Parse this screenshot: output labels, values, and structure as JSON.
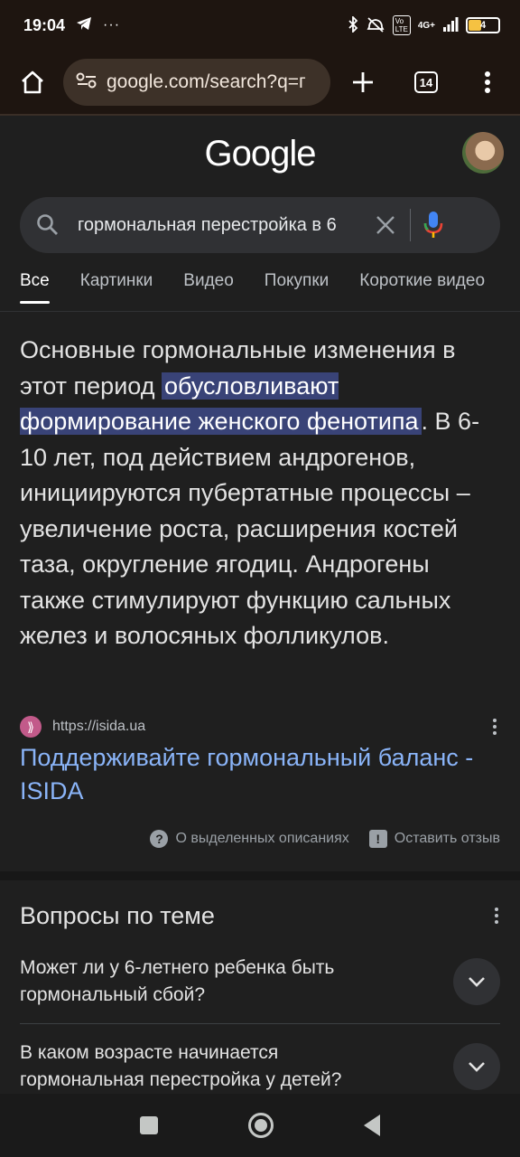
{
  "status": {
    "time": "19:04",
    "network": "4G+",
    "battery": "4"
  },
  "browser": {
    "url": "google.com/search?q=г",
    "tab_count": "14"
  },
  "logo": "Google",
  "search": {
    "query": "гормональная перестройка в 6"
  },
  "tabs": [
    "Все",
    "Картинки",
    "Видео",
    "Покупки",
    "Короткие видео"
  ],
  "snippet": {
    "before": "Основные гормональные изменения в этот период ",
    "highlight": "обусловливают формирование женского фенотипа",
    "after": ". В 6-10 лет, под действием андрогенов, инициируются пубертатные процессы – увеличение роста, расширения костей таза, округление ягодиц. Андрогены также стимулируют функцию сальных желез и волосяных фолликулов."
  },
  "result": {
    "source_url": "https://isida.ua",
    "title": "Поддерживайте гормональный баланс - ISIDA"
  },
  "feedback": {
    "about": "О выделенных описаниях",
    "leave": "Оставить отзыв"
  },
  "people_also_ask": {
    "title": "Вопросы по теме",
    "items": [
      "Может ли у 6-летнего ребенка быть гормональный сбой?",
      "В каком возрасте начинается гормональная перестройка у детей?"
    ]
  },
  "colors": {
    "link": "#8ab4f8",
    "highlight": "#394377",
    "mic_blue": "#4285f4",
    "mic_red": "#ea4335"
  }
}
